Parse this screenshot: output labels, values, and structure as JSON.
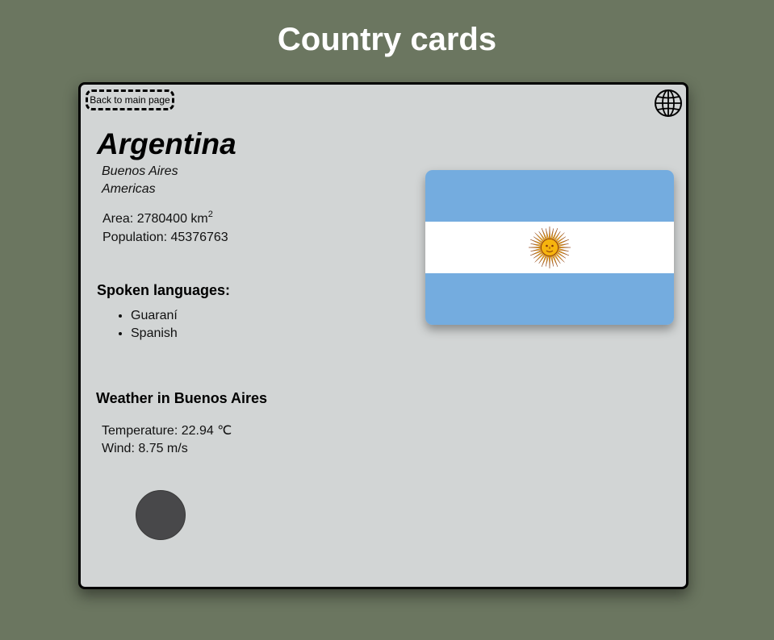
{
  "page": {
    "title": "Country cards"
  },
  "card": {
    "back_label": "Back to main page",
    "globe_icon": "globe-icon",
    "country": "Argentina",
    "capital": "Buenos Aires",
    "region": "Americas",
    "area_label": "Area: 2780400 km",
    "area_unit_sup": "2",
    "population_label": "Population: 45376763",
    "languages_heading": "Spoken languages:",
    "languages": [
      "Guaraní",
      "Spanish"
    ],
    "weather_heading": "Weather in Buenos Aires",
    "temperature_label": "Temperature: 22.94 ℃",
    "wind_label": "Wind: 8.75 m/s",
    "weather_icon": "weather-icon"
  },
  "flag": {
    "name": "argentina-flag",
    "colors": {
      "sky_blue": "#74acdf",
      "white": "#ffffff",
      "sun": "#f6b40e",
      "sun_edge": "#85340a"
    }
  },
  "colors": {
    "background": "#6b7660",
    "card_background": "#d2d5d5",
    "border": "#000000"
  }
}
